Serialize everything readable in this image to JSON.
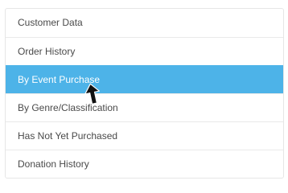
{
  "menu": {
    "items": [
      {
        "label": "Customer Data"
      },
      {
        "label": "Order History"
      },
      {
        "label": "By Event Purchase"
      },
      {
        "label": "By Genre/Classification"
      },
      {
        "label": "Has Not Yet Purchased"
      },
      {
        "label": "Donation History"
      }
    ],
    "active_index": 2
  },
  "colors": {
    "active_background": "#4db3e8",
    "active_text": "#ffffff",
    "text": "#4a4a4a",
    "border": "#e6e6e6"
  },
  "cursor": {
    "icon": "arrow-cursor-icon"
  }
}
